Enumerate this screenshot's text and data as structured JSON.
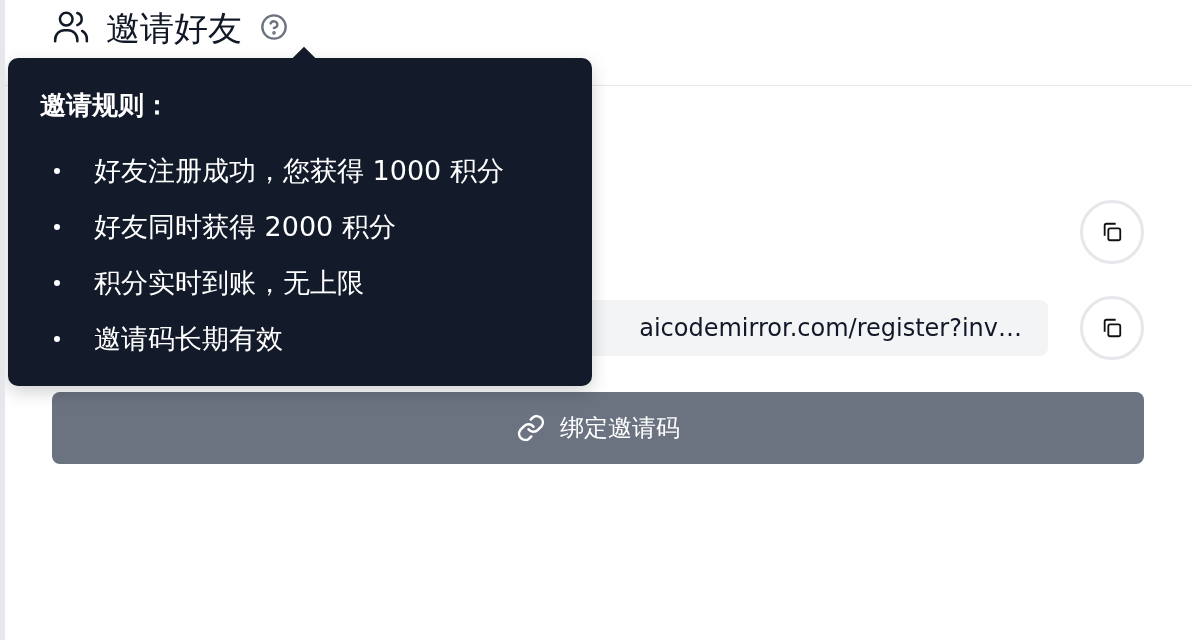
{
  "header": {
    "title": "邀请好友"
  },
  "tooltip": {
    "title": "邀请规则：",
    "items": [
      "好友注册成功，您获得 1000 积分",
      "好友同时获得 2000 积分",
      "积分实时到账，无上限",
      "邀请码长期有效"
    ]
  },
  "invite_link": {
    "value": "aicodemirror.com/register?inv…"
  },
  "bind_button": {
    "label": "绑定邀请码"
  }
}
